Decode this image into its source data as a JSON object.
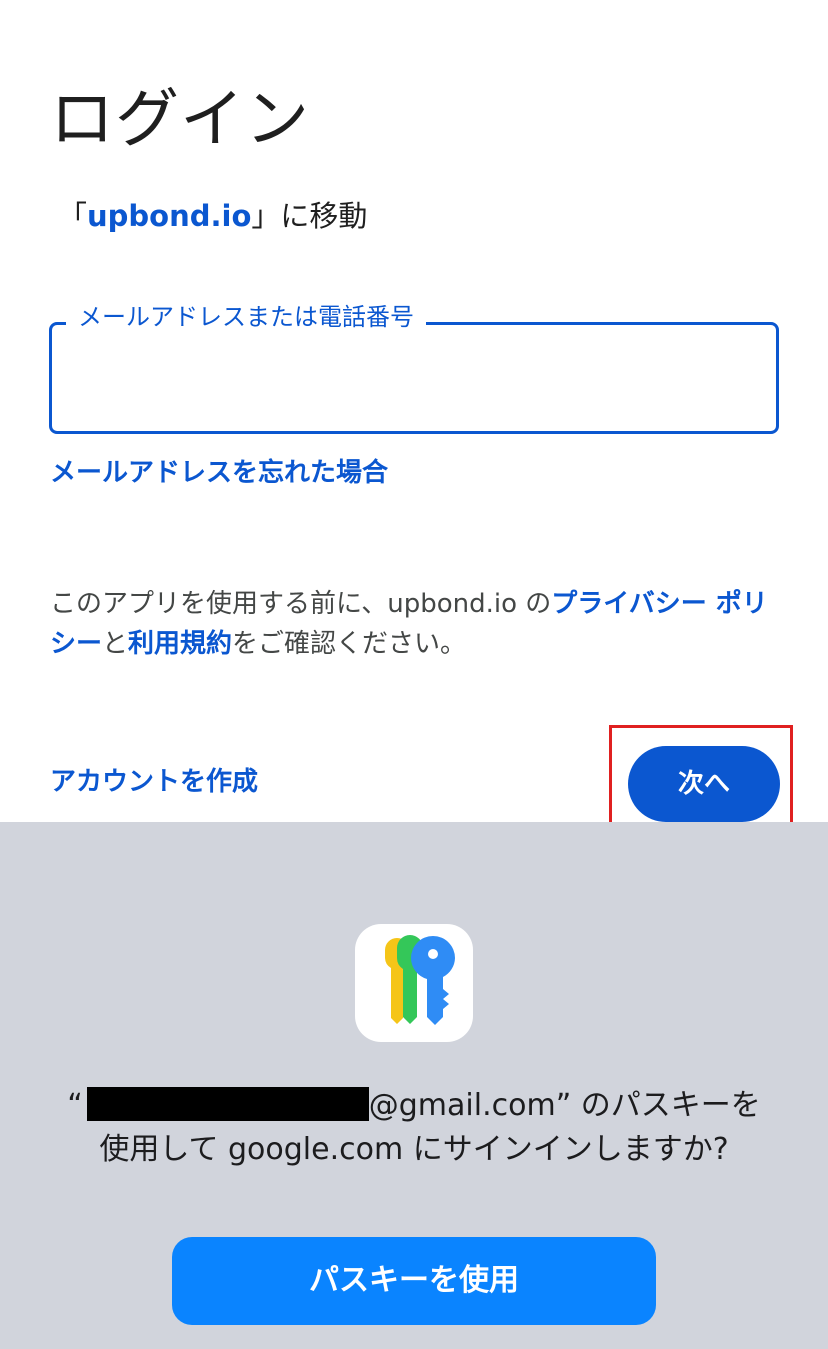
{
  "login": {
    "title": "ログイン",
    "goto_open": "「",
    "goto_domain": "upbond.io",
    "goto_close": "」に移動",
    "email_field": {
      "label": "メールアドレスまたは電話番号",
      "value": ""
    },
    "forgot_email": "メールアドレスを忘れた場合",
    "notice": {
      "part1": "このアプリを使用する前に、upbond.io の",
      "privacy_link": "プライバシー ポリシー",
      "part2": "と",
      "terms_link": "利用規約",
      "part3": "をご確認ください。"
    },
    "create_account": "アカウントを作成",
    "next_button": "次へ",
    "highlight_color": "#e02020",
    "accent_color": "#0b57d0"
  },
  "passkey_sheet": {
    "icon": "passwords-app-icon",
    "prompt_open_quote": "“",
    "prompt_email_suffix": "@gmail.com",
    "prompt_line1_rest": "” のパスキーを",
    "prompt_line2": "使用して google.com にサインインしますか?",
    "use_passkey_button": "パスキーを使用",
    "background_color": "#d1d4dc",
    "button_color": "#0a84ff"
  }
}
